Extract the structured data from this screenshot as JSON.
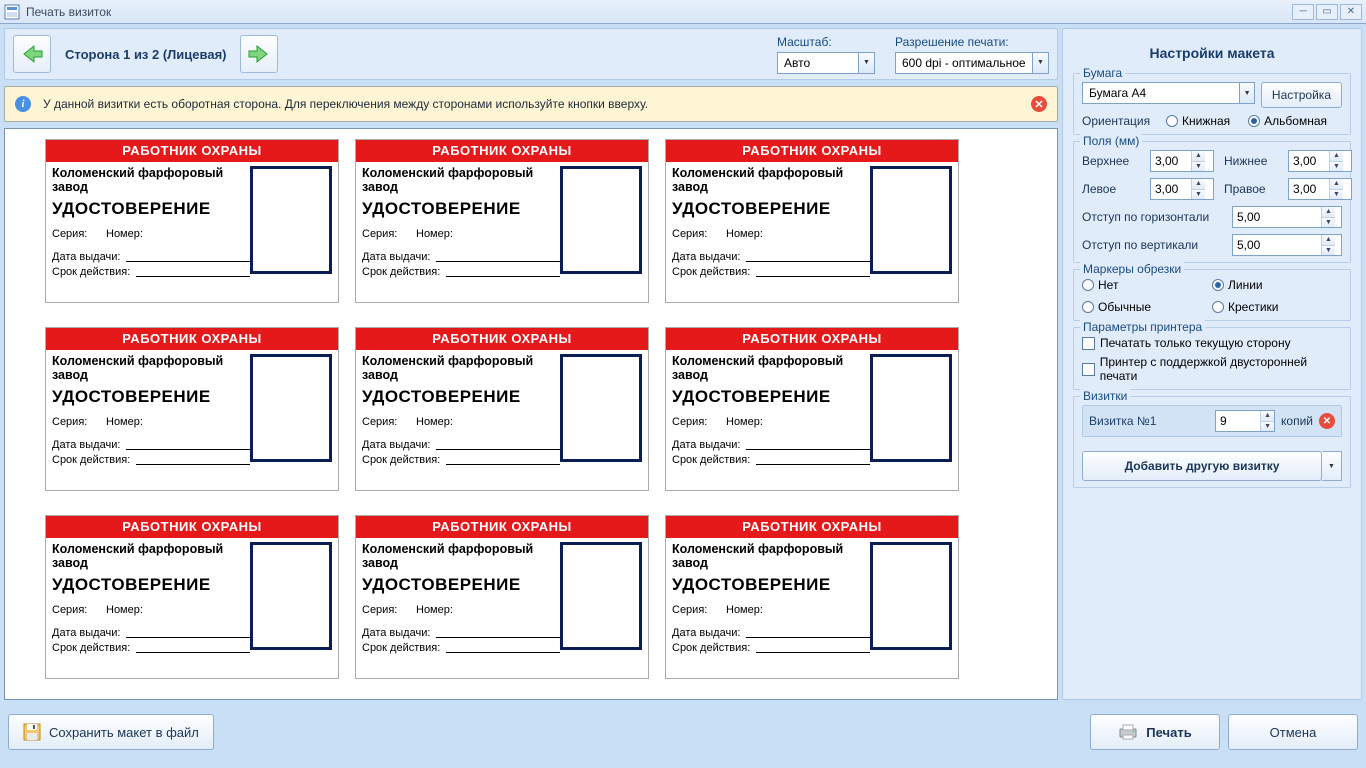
{
  "window": {
    "title": "Печать визиток"
  },
  "nav": {
    "label": "Сторона 1 из 2 (Лицевая)",
    "scale_label": "Масштаб:",
    "scale_value": "Авто",
    "dpi_label": "Разрешение печати:",
    "dpi_value": "600 dpi - оптимальное"
  },
  "info": {
    "text": "У данной визитки есть оборотная сторона. Для переключения между сторонами используйте кнопки вверху."
  },
  "card": {
    "header": "РАБОТНИК ОХРАНЫ",
    "company": "Коломенский фарфоровый завод",
    "cert": "УДОСТОВЕРЕНИЕ",
    "serial_label": "Серия:",
    "number_label": "Номер:",
    "issued_label": "Дата выдачи:",
    "valid_label": "Срок действия:"
  },
  "panel": {
    "title": "Настройки макета",
    "paper": {
      "group": "Бумага",
      "value": "Бумага А4",
      "settings_btn": "Настройка",
      "orientation_label": "Ориентация",
      "orientation_portrait": "Книжная",
      "orientation_landscape": "Альбомная"
    },
    "margins": {
      "group": "Поля (мм)",
      "top_label": "Верхнее",
      "top_value": "3,00",
      "bottom_label": "Нижнее",
      "bottom_value": "3,00",
      "left_label": "Левое",
      "left_value": "3,00",
      "right_label": "Правое",
      "right_value": "3,00",
      "hoffset_label": "Отступ по горизонтали",
      "hoffset_value": "5,00",
      "voffset_label": "Отступ по вертикали",
      "voffset_value": "5,00"
    },
    "crop": {
      "group": "Маркеры обрезки",
      "none": "Нет",
      "lines": "Линии",
      "normal": "Обычные",
      "crosses": "Крестики"
    },
    "printer": {
      "group": "Параметры принтера",
      "current_only": "Печатать только текущую сторону",
      "duplex": "Принтер с поддержкой двусторонней печати"
    },
    "cards_group": {
      "group": "Визитки",
      "item_label": "Визитка №1",
      "item_count": "9",
      "copies_label": "копий",
      "add_btn": "Добавить другую визитку"
    }
  },
  "footer": {
    "save": "Сохранить макет в файл",
    "print": "Печать",
    "cancel": "Отмена"
  }
}
